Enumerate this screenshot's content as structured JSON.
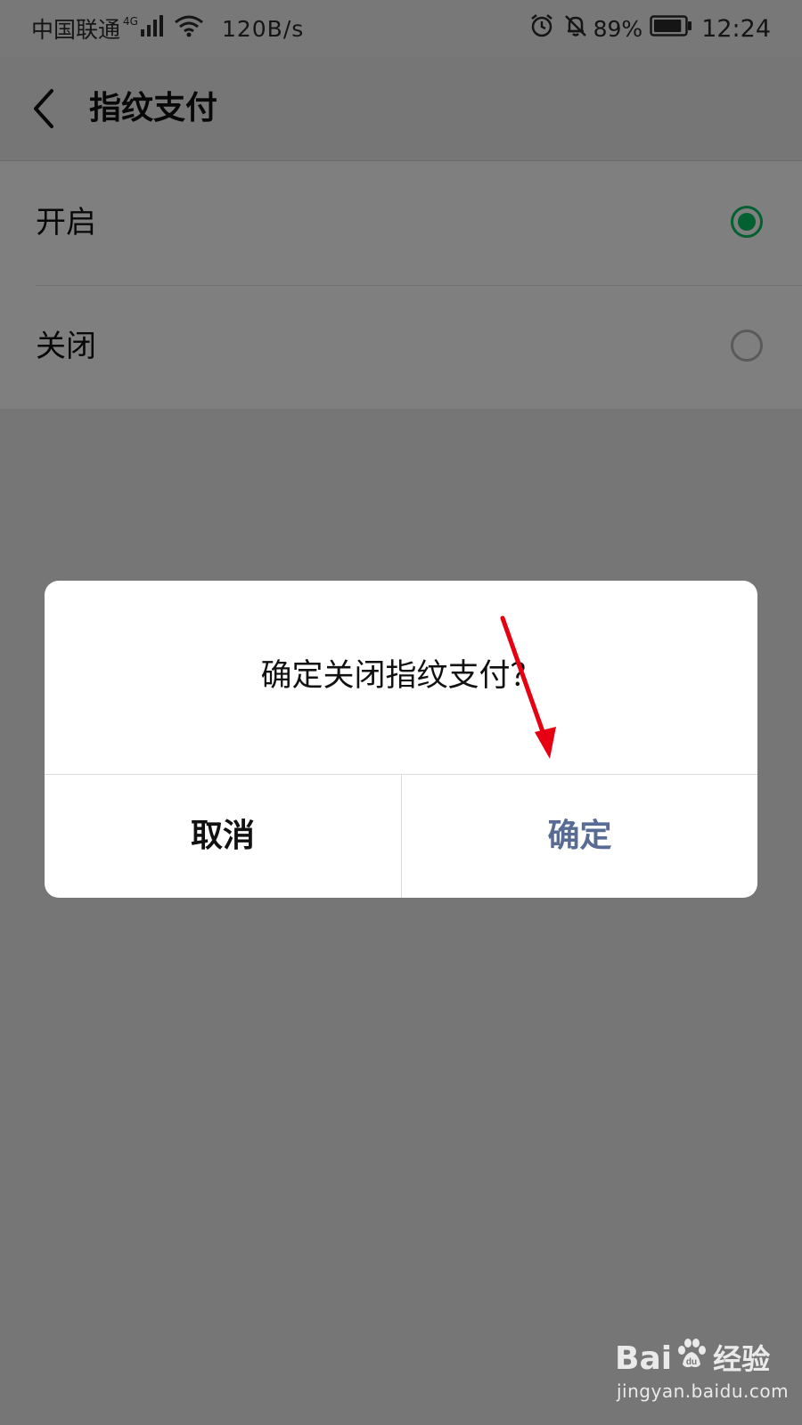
{
  "status_bar": {
    "carrier": "中国联通",
    "network": "4G",
    "speed": "120B/s",
    "battery": "89%",
    "battery_level": 0.89,
    "time": "12:24"
  },
  "header": {
    "title": "指纹支付"
  },
  "options": [
    {
      "label": "开启",
      "selected": true
    },
    {
      "label": "关闭",
      "selected": false
    }
  ],
  "dialog": {
    "message": "确定关闭指纹支付？",
    "cancel_label": "取消",
    "confirm_label": "确定"
  },
  "watermark": {
    "brand_left": "Bai",
    "brand_right": "经验",
    "url": "jingyan.baidu.com"
  },
  "colors": {
    "accent_green": "#07c160",
    "confirm_blue": "#576b95",
    "annotation_red": "#e60012"
  },
  "icons": [
    "back-icon",
    "signal-icon",
    "wifi-icon",
    "alarm-icon",
    "mute-icon",
    "battery-icon",
    "paw-icon"
  ]
}
